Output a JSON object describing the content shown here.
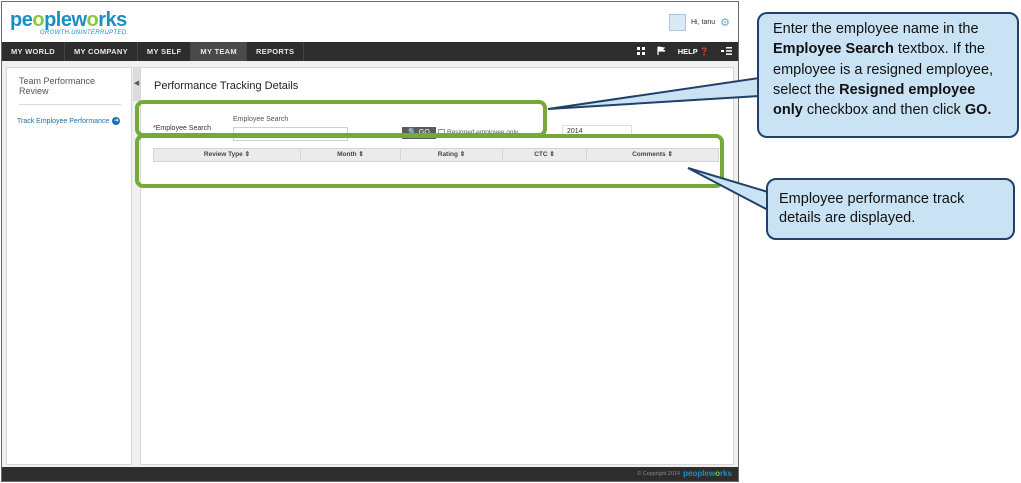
{
  "app": {
    "logo_text_a": "pe",
    "logo_text_b": "o",
    "logo_text_c": "ple",
    "logo_text_d": "w",
    "logo_text_e": "o",
    "logo_text_f": "rks",
    "tagline": "GROWTH.UNINTERRUPTED.",
    "user_greeting": "Hi, tanu",
    "gear_glyph": "⚙"
  },
  "nav": {
    "items": [
      {
        "label": "MY WORLD"
      },
      {
        "label": "MY COMPANY"
      },
      {
        "label": "MY SELF"
      },
      {
        "label": "MY TEAM"
      },
      {
        "label": "REPORTS"
      }
    ],
    "active_index": 3,
    "help_label": "HELP",
    "icons": [
      "grid-icon",
      "flag-icon",
      "help-icon",
      "menu-icon"
    ]
  },
  "sidebar": {
    "title": "Team Performance Review",
    "link": "Track Employee Performance"
  },
  "content": {
    "page_title": "Performance Tracking Details",
    "search_label_req": "*",
    "search_label": "Employee Search",
    "input_label": "Employee Search",
    "input_value": "",
    "go_label": "GO",
    "resigned_label": "Resigned employee only",
    "year_value": "2014",
    "columns": [
      "Review Type",
      "Month",
      "Rating",
      "CTC",
      "Comments"
    ]
  },
  "footer": {
    "copyright": "© Copyright 2014",
    "logo_a": "peoplew",
    "logo_b": "o",
    "logo_c": "rks"
  },
  "callouts": {
    "c1_p1": "Enter the employee name in the ",
    "c1_b1": "Employee Search",
    "c1_p2": " textbox.  If the employee is a resigned employee, select the ",
    "c1_b2": "Resigned employee only",
    "c1_p3": " checkbox and then click ",
    "c1_b3": "GO.",
    "c2_text": "Employee performance track details are displayed."
  },
  "colors": {
    "brand_blue": "#1b8fc5",
    "brand_green": "#8dc63f",
    "nav_bg": "#2d2d2d",
    "highlight_green": "#76a83a",
    "callout_fill": "#c9e3f5",
    "callout_border": "#20416a"
  }
}
